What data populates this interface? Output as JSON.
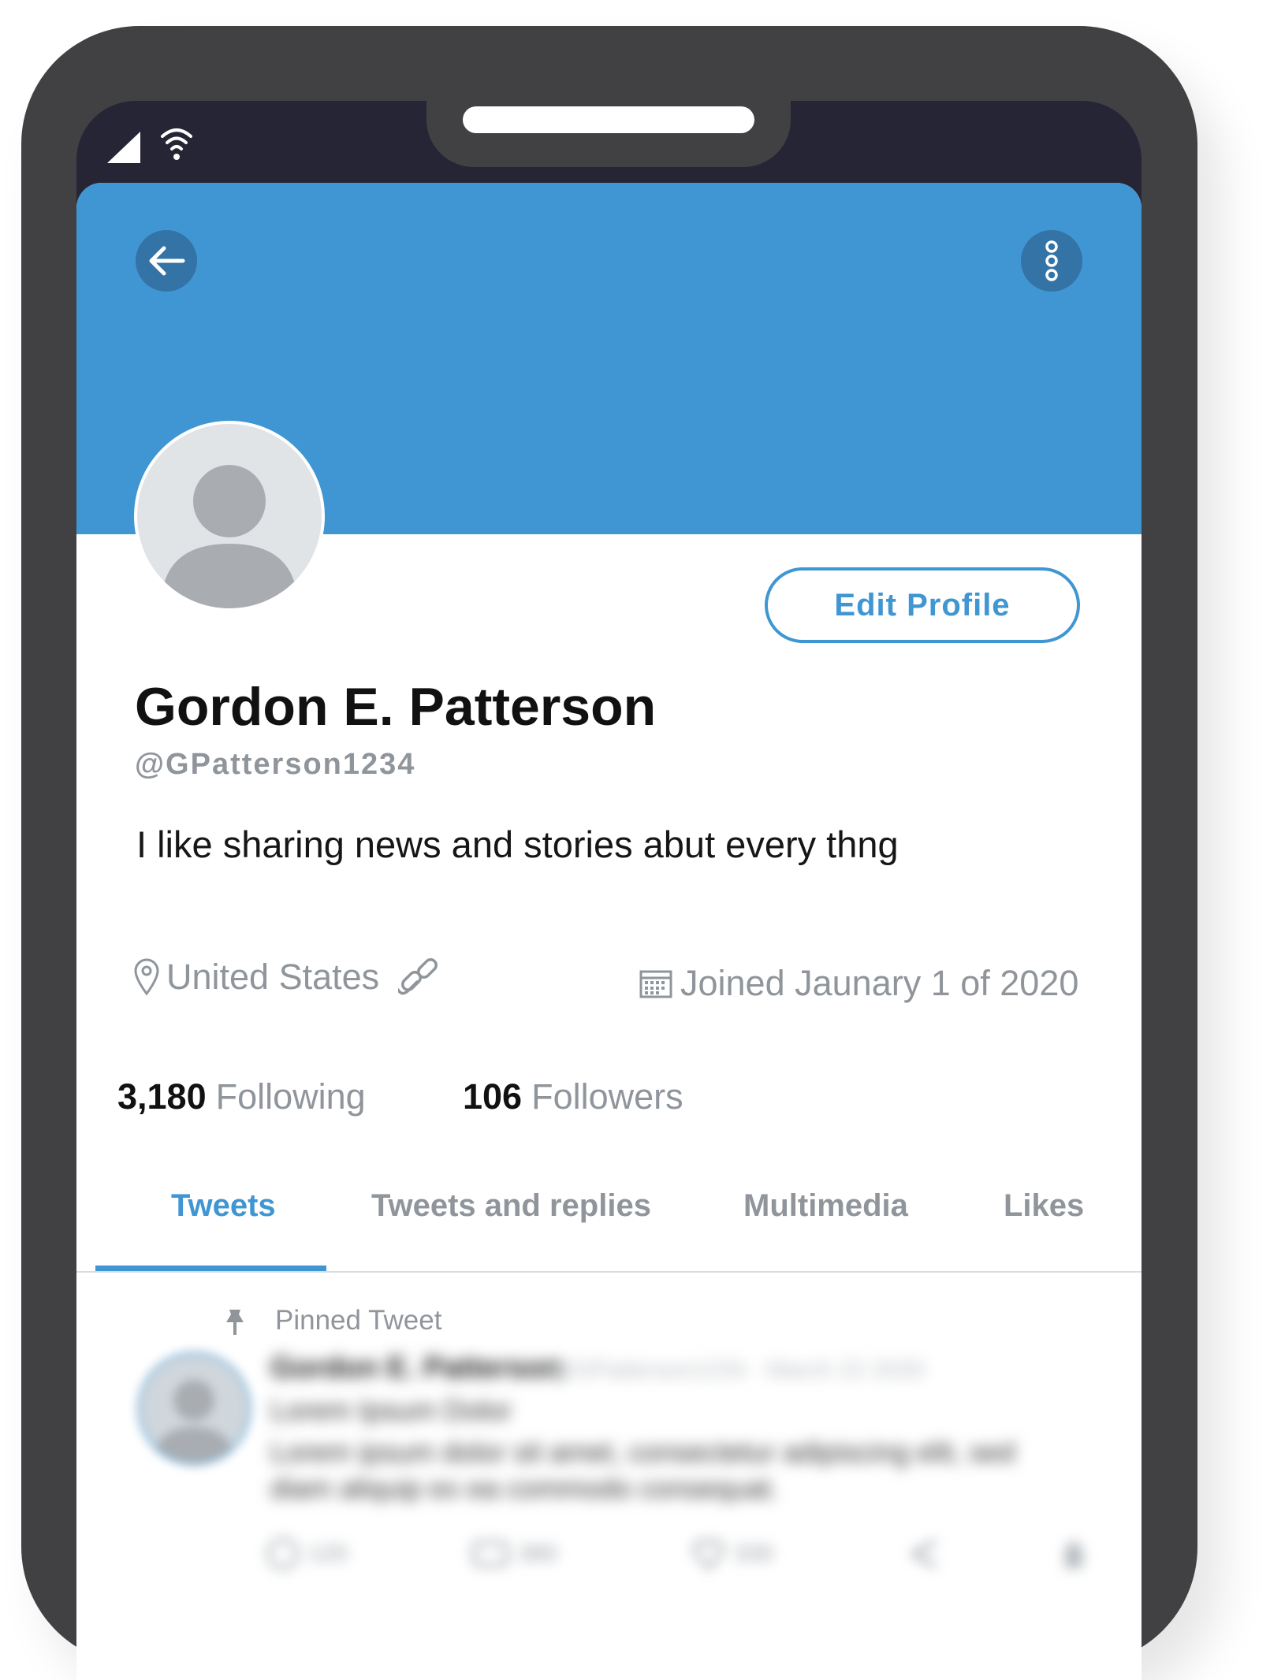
{
  "profile": {
    "name": "Gordon E. Patterson",
    "handle": "@GPatterson1234",
    "bio": "I like sharing news and stories abut every thng",
    "location": "United States",
    "joined": "Joined Jaunary 1 of 2020",
    "following_count": "3,180",
    "following_label": "Following",
    "followers_count": "106",
    "followers_label": "Followers",
    "edit_button": "Edit Profile"
  },
  "tabs": [
    {
      "label": "Tweets",
      "active": true
    },
    {
      "label": "Tweets and replies",
      "active": false
    },
    {
      "label": "Multimedia",
      "active": false
    },
    {
      "label": "Likes",
      "active": false
    }
  ],
  "pinned_tweet": {
    "label": "Pinned Tweet",
    "author": "Gordon E. Patterson",
    "meta": "@GPatterson1234 · March 22 2020",
    "title": "Lorem Ipsum Dolor",
    "text_line1": "Lorem ipsum dolor sit amet, consectetur adipiscing elit, sed",
    "text_line2": "diam aliquip ex ea commodo consequat.",
    "reply_count": "120",
    "retweet_count": "380",
    "like_count": "330"
  },
  "colors": {
    "accent": "#3f96d3",
    "banner": "#3f96d3",
    "phone_frame": "#414143",
    "muted_text": "#8f959b"
  },
  "icons": [
    "signal-icon",
    "wifi-icon",
    "back-arrow-icon",
    "more-vertical-icon",
    "location-pin-icon",
    "link-icon",
    "calendar-icon",
    "pin-icon",
    "reply-icon",
    "retweet-icon",
    "like-icon",
    "share-icon",
    "bookmark-icon"
  ]
}
